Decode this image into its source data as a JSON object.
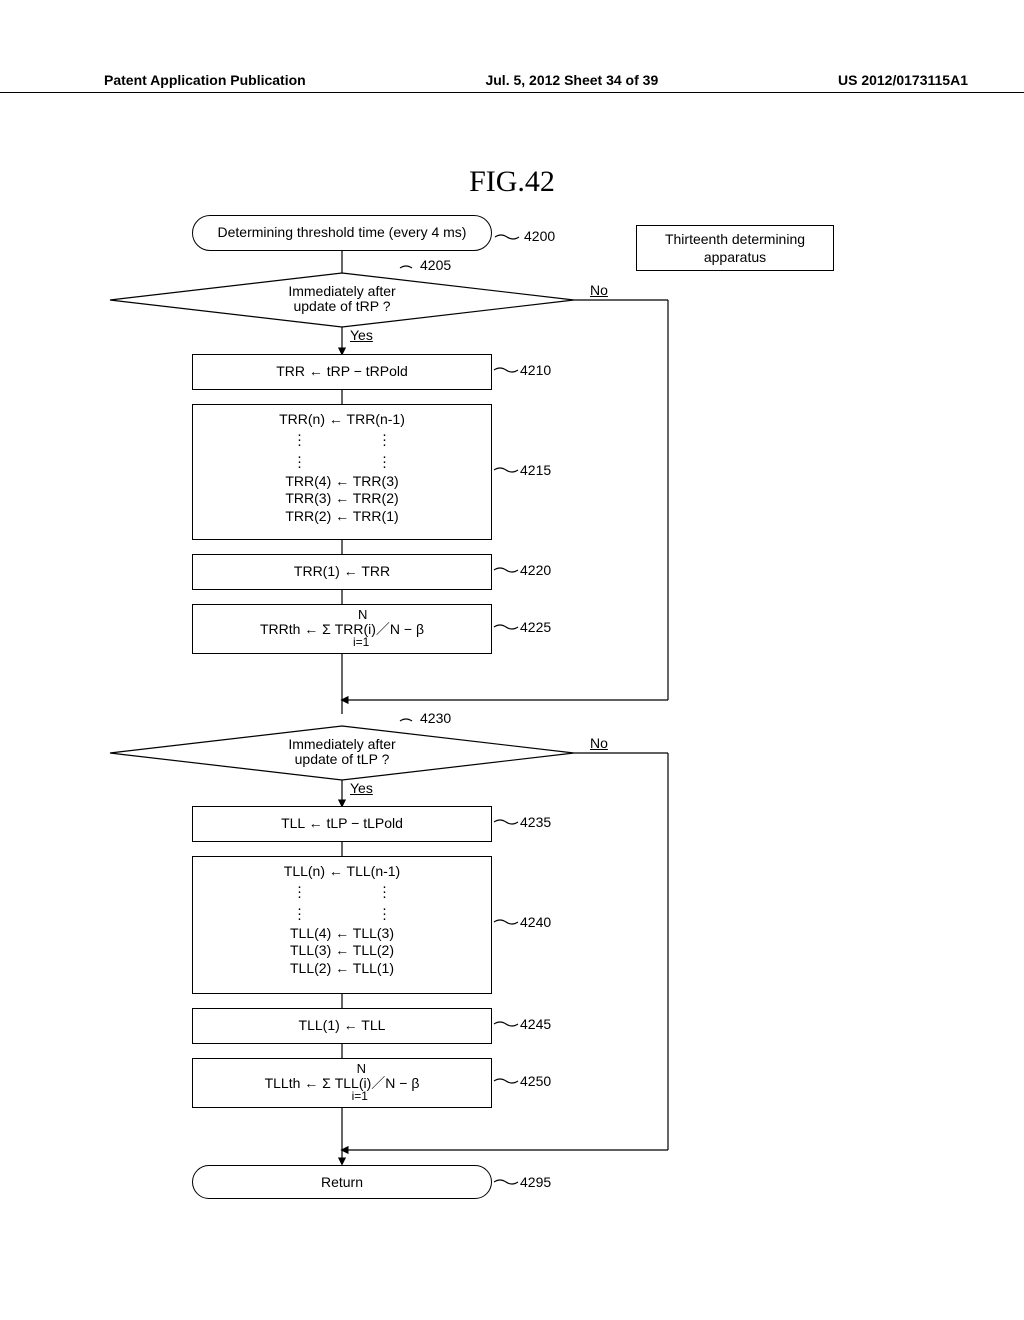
{
  "header": {
    "left": "Patent Application Publication",
    "middle": "Jul. 5, 2012   Sheet 34 of 39",
    "right": "US 2012/0173115A1"
  },
  "figure_title": "FIG.42",
  "device_label": "Thirteenth determining apparatus",
  "flowchart": {
    "start_text": "Determining threshold time (every 4 ms)",
    "return_text": "Return",
    "dec1_text": "Immediately after update of tRP ?",
    "dec2_text": "Immediately after update of tLP ?",
    "p4210": "TRR ← tRP − tRPold",
    "p4215": {
      "line1": "TRR(n) ← TRR(n-1)",
      "line2": "TRR(4) ← TRR(3)",
      "line3": "TRR(3) ← TRR(2)",
      "line4": "TRR(2) ← TRR(1)"
    },
    "p4220": "TRR(1) ← TRR",
    "p4225": {
      "N": "N",
      "body": "TRRth ←   Σ TRR(i)／N − β",
      "i": "i=1"
    },
    "p4235": "TLL ← tLP − tLPold",
    "p4240": {
      "line1": "TLL(n) ← TLL(n-1)",
      "line2": "TLL(4) ← TLL(3)",
      "line3": "TLL(3) ← TLL(2)",
      "line4": "TLL(2) ← TLL(1)"
    },
    "p4245": "TLL(1) ← TLL",
    "p4250": {
      "N": "N",
      "body": "TLLth ←   Σ TLL(i)／N − β",
      "i": "i=1"
    }
  },
  "refs": {
    "r4200": "4200",
    "r4205": "4205",
    "r4210": "4210",
    "r4215": "4215",
    "r4220": "4220",
    "r4225": "4225",
    "r4230": "4230",
    "r4235": "4235",
    "r4240": "4240",
    "r4245": "4245",
    "r4250": "4250",
    "r4295": "4295"
  },
  "yn": {
    "yes": "Yes",
    "no": "No"
  }
}
